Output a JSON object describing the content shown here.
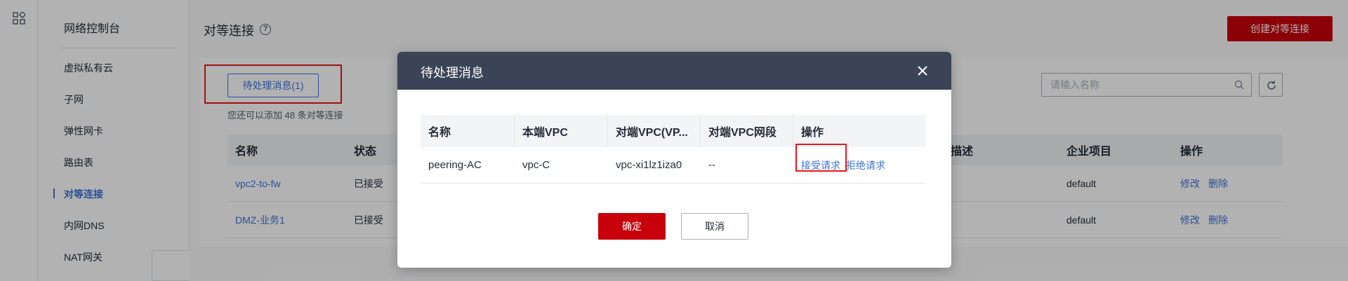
{
  "sidebar": {
    "title": "网络控制台",
    "items": [
      {
        "label": "虚拟私有云"
      },
      {
        "label": "子网"
      },
      {
        "label": "弹性网卡"
      },
      {
        "label": "路由表"
      },
      {
        "label": "对等连接",
        "active": true
      },
      {
        "label": "内网DNS"
      },
      {
        "label": "NAT网关"
      }
    ]
  },
  "header": {
    "title": "对等连接",
    "create_label": "创建对等连接"
  },
  "toolbar": {
    "pending_label": "待处理消息(1)",
    "quota_text": "您还可以添加 48 条对等连接",
    "search_placeholder": "请输入名称"
  },
  "table": {
    "columns": {
      "name": "名称",
      "status": "状态",
      "desc": "描述",
      "project": "企业项目",
      "ops": "操作"
    },
    "rows": [
      {
        "name": "vpc2-to-fw",
        "status": "已接受",
        "project": "default",
        "edit": "修改",
        "delete": "删除"
      },
      {
        "name": "DMZ-业务1",
        "status": "已接受",
        "project": "default",
        "edit": "修改",
        "delete": "删除"
      }
    ]
  },
  "modal": {
    "title": "待处理消息",
    "columns": {
      "name": "名称",
      "local_vpc": "本端VPC",
      "peer_vpc": "对端VPC(VP...",
      "peer_cidr": "对端VPC网段",
      "ops": "操作"
    },
    "row": {
      "name": "peering-AC",
      "local_vpc": "vpc-C",
      "peer_vpc": "vpc-xi1lz1iza0",
      "peer_cidr": "--",
      "accept": "接受请求",
      "reject": "拒绝请求"
    },
    "confirm_label": "确定",
    "cancel_label": "取消"
  },
  "colors": {
    "brand_red": "#c7000b",
    "link_blue": "#3d73d9",
    "modal_header": "#3b4356",
    "highlight": "#e8171c"
  },
  "icons": [
    "grid-apps-icon",
    "help-icon",
    "search-icon",
    "refresh-icon",
    "close-icon"
  ]
}
